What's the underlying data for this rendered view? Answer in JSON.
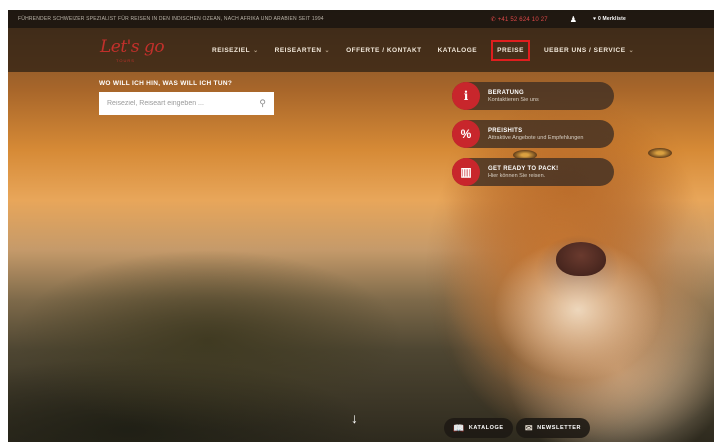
{
  "topbar": {
    "tagline": "Führender Schweizer Spezialist für Reisen in den Indischen Ozean, nach Afrika und Arabien seit 1994",
    "phone": "+41 52 624 10 27",
    "user_icon": "user-icon",
    "wishlist": "0 Merkliste",
    "wishlist_icon": "heart-icon"
  },
  "logo": {
    "text": "Let's go",
    "sub": "TOURS"
  },
  "nav": {
    "items": [
      {
        "label": "Reiseziel",
        "caret": "⌄"
      },
      {
        "label": "Reisearten",
        "caret": "⌄"
      },
      {
        "label": "Offerte / Kontakt",
        "caret": ""
      },
      {
        "label": "Kataloge",
        "caret": ""
      },
      {
        "label": "Preise",
        "caret": ""
      },
      {
        "label": "Ueber uns / Service",
        "caret": "⌄"
      }
    ]
  },
  "search": {
    "label": "WO WILL ICH HIN, WAS WILL ICH TUN?",
    "placeholder": "Reiseziel, Reiseart eingeben ...",
    "icon": "search-icon"
  },
  "quick_links": [
    {
      "icon": "info-icon",
      "glyph": "i",
      "title": "BERATUNG",
      "subtitle": "Kontaktieren Sie uns"
    },
    {
      "icon": "percent-icon",
      "glyph": "%",
      "title": "PREISHITS",
      "subtitle": "Attraktive Angebote und Empfehlungen"
    },
    {
      "icon": "map-icon",
      "glyph": "▥",
      "title": "GET READY TO PACK!",
      "subtitle": "Hier können Sie reisen."
    }
  ],
  "footer_buttons": {
    "kataloge": "KATALOGE",
    "newsletter": "NEWSLETTER"
  },
  "colors": {
    "brand_red": "#c8262c",
    "highlight_outline": "#e01e1e"
  }
}
